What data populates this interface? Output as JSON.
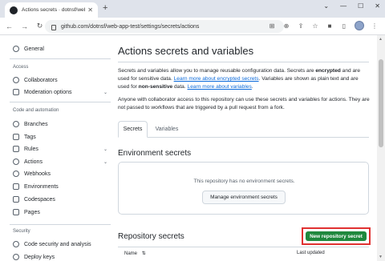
{
  "browser": {
    "tab_title": "Actions secrets · dotnsf/web-ap",
    "new_tab": "+",
    "url": "github.com/dotnsf/web-app-test/settings/secrets/actions"
  },
  "sidebar": {
    "general": "General",
    "access_heading": "Access",
    "collaborators": "Collaborators",
    "moderation": "Moderation options",
    "code_heading": "Code and automation",
    "branches": "Branches",
    "tags": "Tags",
    "rules": "Rules",
    "actions": "Actions",
    "webhooks": "Webhooks",
    "environments": "Environments",
    "codespaces": "Codespaces",
    "pages": "Pages",
    "security_heading": "Security",
    "code_security": "Code security and analysis",
    "deploy_keys": "Deploy keys"
  },
  "main": {
    "title": "Actions secrets and variables",
    "desc1_a": "Secrets and variables allow you to manage reusable configuration data. Secrets are ",
    "desc1_b": "encrypted",
    "desc1_c": " and are used for sensitive data. ",
    "desc1_link1": "Learn more about encrypted secrets",
    "desc1_d": ". Variables are shown as plain text and are used for ",
    "desc1_e": "non-sensitive",
    "desc1_f": " data. ",
    "desc1_link2": "Learn more about variables",
    "desc1_g": ".",
    "desc2": "Anyone with collaborator access to this repository can use these secrets and variables for actions. They are not passed to workflows that are triggered by a pull request from a fork.",
    "tab_secrets": "Secrets",
    "tab_variables": "Variables",
    "env_title": "Environment secrets",
    "env_empty": "This repository has no environment secrets.",
    "env_button": "Manage environment secrets",
    "repo_title": "Repository secrets",
    "new_secret_button": "New repository secret",
    "col_name": "Name",
    "col_sort": "⇅",
    "col_updated": "Last updated"
  },
  "colors": {
    "link": "#0969da",
    "primary_button": "#1f883d",
    "highlight_box": "#e03131"
  }
}
